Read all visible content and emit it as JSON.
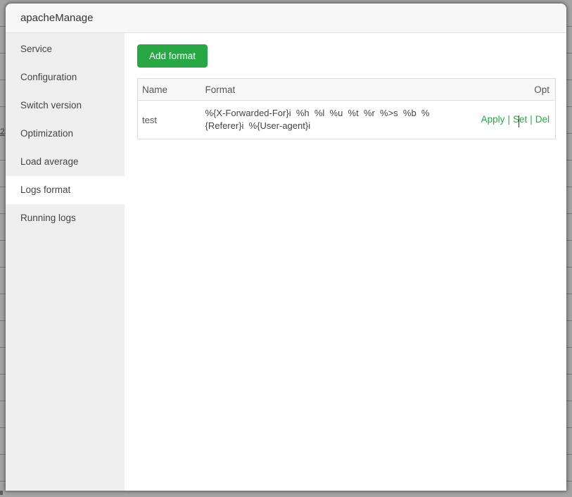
{
  "window": {
    "title": "apacheManage"
  },
  "sidebar": {
    "items": [
      {
        "label": "Service",
        "active": false
      },
      {
        "label": "Configuration",
        "active": false
      },
      {
        "label": "Switch version",
        "active": false
      },
      {
        "label": "Optimization",
        "active": false
      },
      {
        "label": "Load average",
        "active": false
      },
      {
        "label": "Logs format",
        "active": true
      },
      {
        "label": "Running logs",
        "active": false
      }
    ]
  },
  "main": {
    "add_format_button": "Add format",
    "table": {
      "columns": {
        "name": "Name",
        "format": "Format",
        "opt": "Opt"
      },
      "rows": [
        {
          "name": "test",
          "format": "%{X-Forwarded-For}i  %h  %l  %u  %t  %r  %>s  %b  %{Referer}i  %{User-agent}i",
          "actions": {
            "apply": "Apply",
            "set": "Set",
            "del": "Del"
          },
          "separator": "|"
        }
      ]
    }
  },
  "backdrop": {
    "partial_page_text": "2"
  },
  "colors": {
    "accent_green": "#28a745",
    "header_bg": "#f7f7f7",
    "sidebar_bg": "#efefef",
    "backdrop_gray": "#a3a3a3",
    "border_gray": "#dddddd"
  }
}
